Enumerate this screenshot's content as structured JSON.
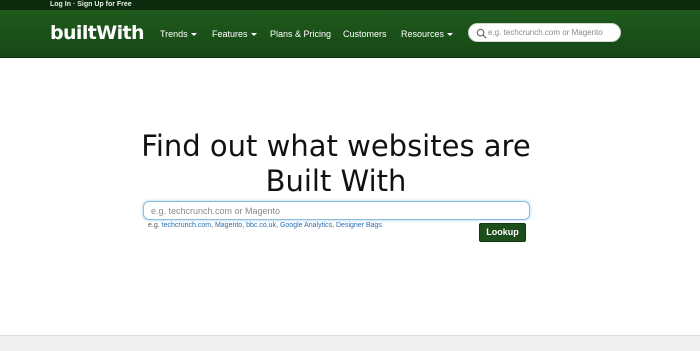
{
  "topbar": {
    "login": "Log In",
    "separator": " · ",
    "signup": "Sign Up for Free"
  },
  "header": {
    "logo_text": "builtWith",
    "nav": {
      "trends": "Trends",
      "features": "Features",
      "plans": "Plans & Pricing",
      "customers": "Customers",
      "resources": "Resources"
    },
    "search": {
      "placeholder": "e.g. techcrunch.com or Magento",
      "value": ""
    }
  },
  "main": {
    "headline_line1": "Find out what websites are",
    "headline_line2": "Built With",
    "search": {
      "placeholder": "e.g. techcrunch.com or Magento",
      "value": ""
    },
    "examples_prefix": "e.g.",
    "examples": [
      "techcrunch.com",
      "Magento",
      "bbc.co.uk",
      "Google Analytics",
      "Designer Bags"
    ],
    "lookup_label": "Lookup"
  },
  "colors": {
    "topbar": "#0c2a0c",
    "navbar": "#1b521a",
    "lookup_button": "#1d4d1b",
    "example_link": "#2a6fb0",
    "search_focus_border": "#8cbcdc"
  },
  "icons": {
    "header_search": "search-icon",
    "nav_dropdown": "caret-down-icon"
  }
}
